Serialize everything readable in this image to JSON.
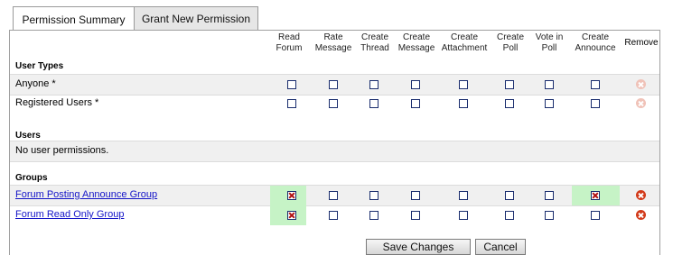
{
  "tabs": {
    "summary": "Permission Summary",
    "grant": "Grant New Permission"
  },
  "columns": {
    "read_forum": [
      "Read",
      "Forum"
    ],
    "rate_message": [
      "Rate",
      "Message"
    ],
    "create_thread": [
      "Create",
      "Thread"
    ],
    "create_message": [
      "Create",
      "Message"
    ],
    "create_attachment": [
      "Create",
      "Attachment"
    ],
    "create_poll": [
      "Create",
      "Poll"
    ],
    "vote_in_poll": [
      "Vote in",
      "Poll"
    ],
    "create_announce": [
      "Create",
      "Announce"
    ],
    "remove": "Remove"
  },
  "user_types": {
    "heading": "User Types",
    "rows": [
      {
        "name": "Anyone *",
        "checked": [
          false,
          false,
          false,
          false,
          false,
          false,
          false,
          false
        ],
        "remove_enabled": false
      },
      {
        "name": "Registered Users *",
        "checked": [
          false,
          false,
          false,
          false,
          false,
          false,
          false,
          false
        ],
        "remove_enabled": false
      }
    ]
  },
  "users": {
    "heading": "Users",
    "empty_text": "No user permissions."
  },
  "groups": {
    "heading": "Groups",
    "rows": [
      {
        "name": "Forum Posting Announce Group",
        "checked": [
          true,
          false,
          false,
          false,
          false,
          false,
          false,
          true
        ],
        "remove_enabled": true
      },
      {
        "name": "Forum Read Only Group",
        "checked": [
          true,
          false,
          false,
          false,
          false,
          false,
          false,
          false
        ],
        "remove_enabled": true
      }
    ]
  },
  "buttons": {
    "save": "Save Changes",
    "cancel": "Cancel"
  },
  "colors": {
    "granted_bg": "#c6f3c6",
    "link": "#1414c8",
    "remove_enabled": "#d23a1a",
    "remove_disabled": "#f0c2b8"
  }
}
